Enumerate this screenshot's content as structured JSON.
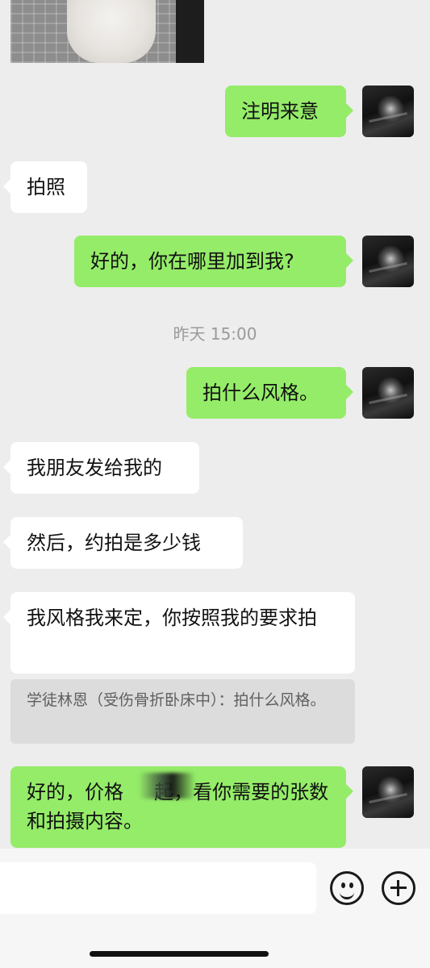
{
  "messages": {
    "m1": "注明来意",
    "m2": "拍照",
    "m3": "好的，你在哪里加到我?",
    "timestamp": "昨天 15:00",
    "m4": "拍什么风格。",
    "m5": "我朋友发给我的",
    "m6": "然后，约拍是多少钱",
    "m7": "我风格我来定，你按照我的要求拍",
    "quote": "学徒林恩（受伤骨折卧床中）：拍什么风格。",
    "m8": "好的，价格     起，看你需要的张数和拍摄内容。"
  },
  "colors": {
    "background": "#ededed",
    "outgoing_bubble": "#95ec69",
    "incoming_bubble": "#ffffff"
  },
  "icons": {
    "emoji": "emoji-icon",
    "add": "plus-icon"
  }
}
